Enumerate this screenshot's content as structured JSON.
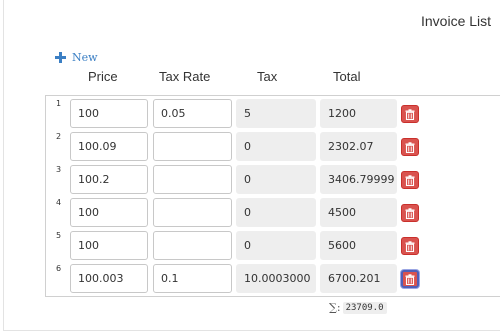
{
  "header": {
    "title": "Invoice List"
  },
  "toolbar": {
    "new_label": "New",
    "new_icon": "plus-icon"
  },
  "columns": {
    "price": "Price",
    "tax_rate": "Tax Rate",
    "tax": "Tax",
    "total": "Total"
  },
  "rows": [
    {
      "num": "1",
      "price": "100",
      "tax_rate": "0.05",
      "tax": "5",
      "total": "1200"
    },
    {
      "num": "2",
      "price": "100.09",
      "tax_rate": "",
      "tax": "0",
      "total": "2302.07"
    },
    {
      "num": "3",
      "price": "100.2",
      "tax_rate": "",
      "tax": "0",
      "total": "3406.79999"
    },
    {
      "num": "4",
      "price": "100",
      "tax_rate": "",
      "tax": "0",
      "total": "4500"
    },
    {
      "num": "5",
      "price": "100",
      "tax_rate": "",
      "tax": "0",
      "total": "5600"
    },
    {
      "num": "6",
      "price": "100.003",
      "tax_rate": "0.1",
      "tax": "10.0003000",
      "total": "6700.201"
    }
  ],
  "summary": {
    "symbol": "∑:",
    "value": "23709.0"
  },
  "colors": {
    "accent": "#3b7fc4",
    "delete": "#d9534f",
    "readonly_bg": "#eeeeee"
  }
}
